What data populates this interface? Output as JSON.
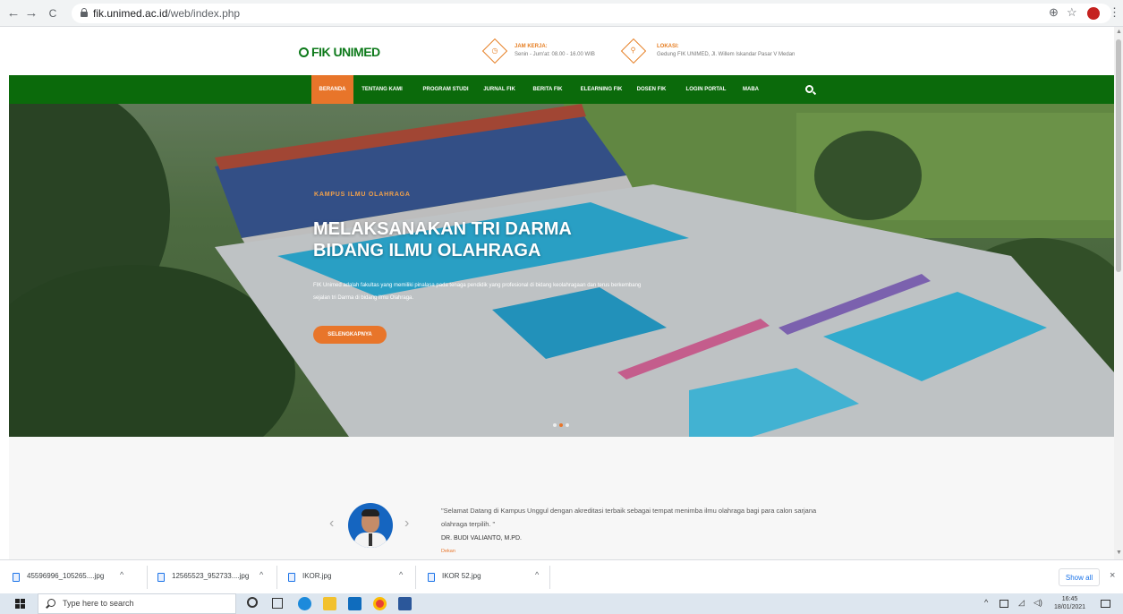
{
  "browser": {
    "url_domain": "fik.unimed.ac.id",
    "url_path": "/web/index.php",
    "back": "←",
    "forward": "→",
    "reload": "C",
    "zoom_icon": "zoom-icon",
    "star_icon": "star-icon",
    "menu": "⋮"
  },
  "header": {
    "logo_text": "FIK UNIMED",
    "hours_title": "JAM KERJA:",
    "hours_text": "Senin - Jum'at: 08.00 - 16.00 WIB",
    "location_title": "LOKASI:",
    "location_text": "Gedung FIK UNIMED, Jl. Willem Iskandar Pasar V Medan"
  },
  "nav": {
    "items": [
      "BERANDA",
      "TENTANG KAMI",
      "PROGRAM STUDI",
      "JURNAL FIK",
      "BERITA FIK",
      "ELEARNING FIK",
      "DOSEN FIK",
      "LOGIN PORTAL",
      "MABA"
    ],
    "active": "BERANDA"
  },
  "hero": {
    "kicker": "KAMPUS ILMU OLAHRAGA",
    "title": "MELAKSANAKAN TRI DARMA BIDANG ILMU OLAHRAGA",
    "description": "FIK Unimed adalah fakultas yang memiliki pinalasa pada tenaga pendidik yang profesional di bidang keolahragaan dan terus berkembang sejalan tri Darma di bidang ilmu Olahraga.",
    "button": "SELENGKAPNYA",
    "slide_count": 3,
    "active_slide": 2
  },
  "testimonial": {
    "quote": "\"Selamat Datang di Kampus Unggul dengan akreditasi terbaik sebagai tempat menimba ilmu olahraga bagi para calon sarjana olahraga terpilih. \"",
    "name": "DR. BUDI VALIANTO, M.PD.",
    "role": "Dekan",
    "prev": "‹",
    "next": "›"
  },
  "downloads": {
    "files": [
      "45596996_105265....jpg",
      "12565523_952733....jpg",
      "IKOR.jpg",
      "IKOR 52.jpg"
    ],
    "show_all": "Show all",
    "close": "×"
  },
  "taskbar": {
    "search_placeholder": "Type here to search",
    "time": "16:45",
    "date": "18/01/2021"
  },
  "colors": {
    "nav_green": "#0b6a0b",
    "accent_orange": "#e8752a",
    "logo_green": "#0e7a1b"
  }
}
